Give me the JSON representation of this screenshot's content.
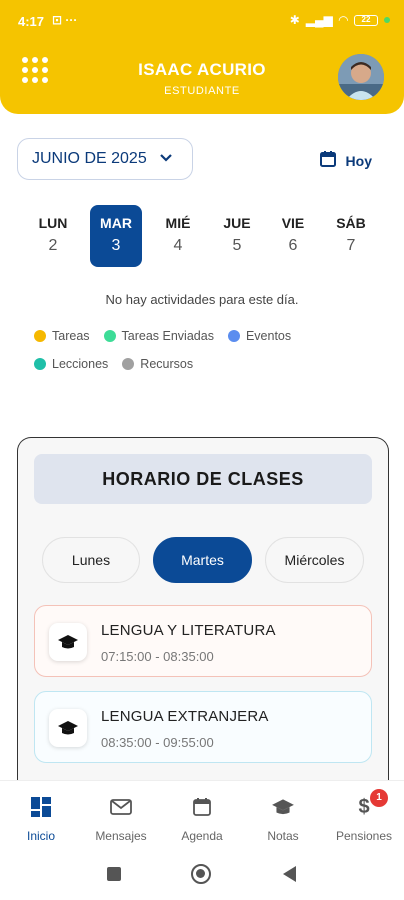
{
  "status_bar": {
    "time": "4:17",
    "battery": "22"
  },
  "header": {
    "name": "ISAAC ACURIO",
    "role": "ESTUDIANTE"
  },
  "calendar": {
    "month_label": "JUNIO DE 2025",
    "today_label": "Hoy",
    "days": [
      {
        "name": "LUN",
        "num": "2"
      },
      {
        "name": "MAR",
        "num": "3"
      },
      {
        "name": "MIÉ",
        "num": "4"
      },
      {
        "name": "JUE",
        "num": "5"
      },
      {
        "name": "VIE",
        "num": "6"
      },
      {
        "name": "SÁB",
        "num": "7"
      }
    ],
    "no_activity": "No hay actividades para este día."
  },
  "legend": [
    {
      "label": "Tareas",
      "color": "#f5b800"
    },
    {
      "label": "Tareas Enviadas",
      "color": "#3ddc97"
    },
    {
      "label": "Eventos",
      "color": "#5b8def"
    },
    {
      "label": "Lecciones",
      "color": "#1fbfa8"
    },
    {
      "label": "Recursos",
      "color": "#a0a0a0"
    }
  ],
  "schedule": {
    "title": "HORARIO DE CLASES",
    "tabs": [
      "Lunes",
      "Martes",
      "Miércoles"
    ],
    "active_tab": "Martes",
    "classes": [
      {
        "name": "LENGUA Y LITERATURA",
        "time": "07:15:00 - 08:35:00"
      },
      {
        "name": "LENGUA EXTRANJERA",
        "time": "08:35:00 - 09:55:00"
      }
    ]
  },
  "bottom_nav": {
    "items": [
      {
        "label": "Inicio",
        "icon": "home-grid-icon"
      },
      {
        "label": "Mensajes",
        "icon": "mail-icon"
      },
      {
        "label": "Agenda",
        "icon": "calendar-icon"
      },
      {
        "label": "Notas",
        "icon": "graduation-cap-icon"
      },
      {
        "label": "Pensiones",
        "icon": "dollar-icon"
      }
    ],
    "active": "Inicio",
    "pensiones_badge": "1"
  },
  "colors": {
    "primary": "#0b4a96",
    "header": "#f5c400"
  }
}
